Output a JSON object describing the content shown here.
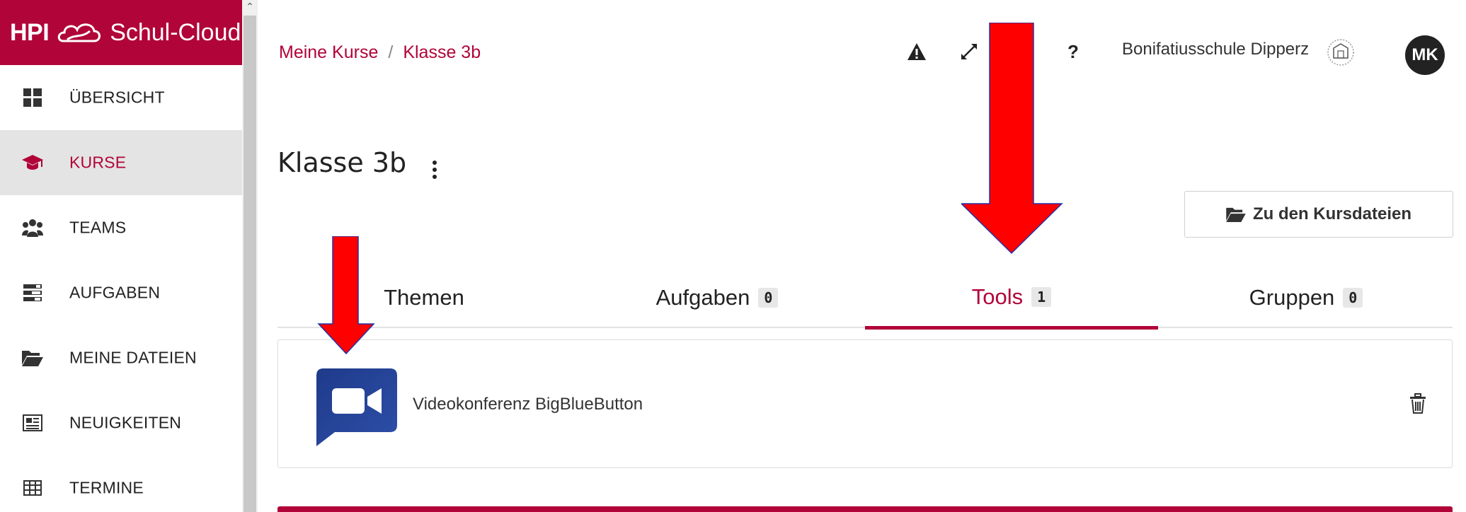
{
  "sidebar": {
    "logo_prefix": "HPI",
    "logo_brand": "Schul-Cloud",
    "items": [
      {
        "label": "ÜBERSICHT",
        "icon": "dashboard-icon"
      },
      {
        "label": "KURSE",
        "icon": "graduation-cap-icon"
      },
      {
        "label": "TEAMS",
        "icon": "users-icon"
      },
      {
        "label": "AUFGABEN",
        "icon": "tasks-icon"
      },
      {
        "label": "MEINE DATEIEN",
        "icon": "folder-open-icon"
      },
      {
        "label": "NEUIGKEITEN",
        "icon": "newspaper-icon"
      },
      {
        "label": "TERMINE",
        "icon": "calendar-table-icon"
      }
    ],
    "active_item": "KURSE"
  },
  "header": {
    "breadcrumb": [
      "Meine Kurse",
      "Klasse 3b"
    ],
    "breadcrumb_separator": "/",
    "help_symbol": "?",
    "school_name": "Bonifatiusschule Dipperz",
    "avatar_initials": "MK",
    "icons": [
      "warning-icon",
      "fullscreen-icon",
      "help-icon",
      "school-logo-icon"
    ]
  },
  "course": {
    "title": "Klasse 3b",
    "files_button_label": "Zu den Kursdateien"
  },
  "tabs": [
    {
      "label": "Themen",
      "count": null
    },
    {
      "label": "Aufgaben",
      "count": "0"
    },
    {
      "label": "Tools",
      "count": "1",
      "active": true
    },
    {
      "label": "Gruppen",
      "count": "0"
    }
  ],
  "tools": [
    {
      "name": "Videokonferenz BigBlueButton",
      "icon": "video-camera-icon"
    }
  ],
  "colors": {
    "brand": "#b10438",
    "annotation_arrow": "#ff0000",
    "tool_icon": "#2b3f8f"
  }
}
